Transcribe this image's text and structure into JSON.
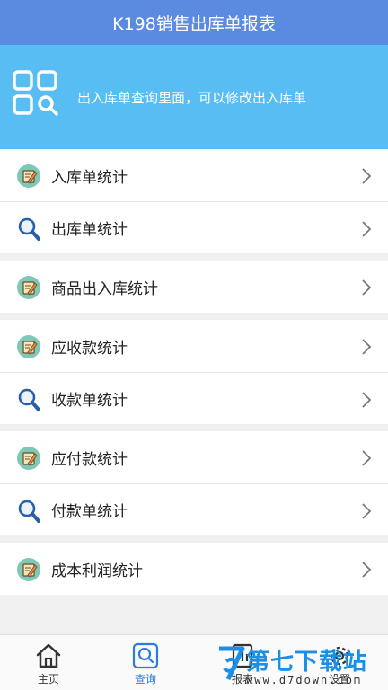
{
  "header": {
    "title": "K198销售出库单报表"
  },
  "banner": {
    "text": "出入库单查询里面，可以修改出入库单",
    "icon": "grid-search-icon"
  },
  "groups": [
    {
      "rows": [
        {
          "label": "入库单统计",
          "icon": "edit-icon"
        },
        {
          "label": "出库单统计",
          "icon": "search-icon"
        }
      ]
    },
    {
      "rows": [
        {
          "label": "商品出入库统计",
          "icon": "edit-icon"
        }
      ]
    },
    {
      "rows": [
        {
          "label": "应收款统计",
          "icon": "edit-icon"
        },
        {
          "label": "收款单统计",
          "icon": "search-icon"
        }
      ]
    },
    {
      "rows": [
        {
          "label": "应付款统计",
          "icon": "edit-icon"
        },
        {
          "label": "付款单统计",
          "icon": "search-icon"
        }
      ]
    },
    {
      "rows": [
        {
          "label": "成本利润统计",
          "icon": "edit-icon"
        }
      ]
    }
  ],
  "tabbar": {
    "tabs": [
      {
        "label": "主页",
        "icon": "home-icon"
      },
      {
        "label": "查询",
        "icon": "search-icon",
        "active": true
      },
      {
        "label": "报表",
        "icon": "report-icon"
      },
      {
        "label": "设置",
        "icon": "gear-icon"
      }
    ]
  },
  "watermark": {
    "title": "第七下载站",
    "url": "www.d7down.com"
  },
  "colors": {
    "header": "#5b8be0",
    "banner": "#58bdf3",
    "active_tab": "#2e7be0"
  }
}
